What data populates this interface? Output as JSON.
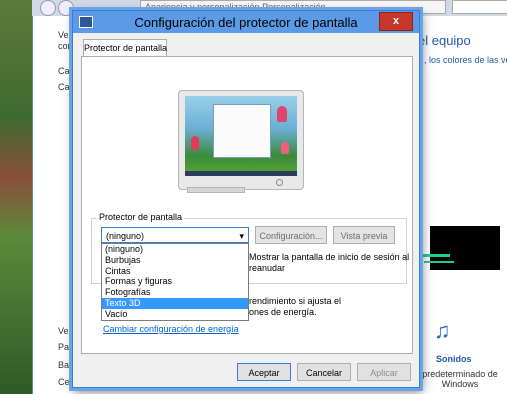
{
  "background": {
    "address_text": "Apariencia y personalización  Personalización",
    "left_texts": [
      "Ven",
      "con",
      "Car",
      "Car",
      "Ver",
      "Par",
      "Bar",
      "Cer"
    ],
    "right_title": "el equipo",
    "right_subtitle": ", los colores de las ven",
    "sounds_label": "Sonidos",
    "default_label": "predeterminado de Windows"
  },
  "dialog": {
    "title": "Configuración del protector de pantalla",
    "close_label": "x",
    "tab_label": "Protector de pantalla",
    "group_label": "Protector de pantalla",
    "selected_value": "(ninguno)",
    "settings_button": "Configuración...",
    "preview_button": "Vista previa",
    "resume_text_line1": "Mostrar la pantalla de inicio de sesión al",
    "resume_text_line2": "reanudar",
    "power_text_line1": "rendimiento si ajusta el",
    "power_text_line2": "ones de energía.",
    "power_link": "Cambiar configuración de energía",
    "dropdown_options": [
      "(ninguno)",
      "Burbujas",
      "Cintas",
      "Formas y figuras",
      "Fotografías",
      "Texto 3D",
      "Vacío"
    ],
    "highlighted_option": "Texto 3D",
    "ok_button": "Aceptar",
    "cancel_button": "Cancelar",
    "apply_button": "Aplicar"
  },
  "colors": {
    "titlebar": "#5a9ae6",
    "close": "#c7372a",
    "highlight": "#3399ff",
    "link": "#0066cc"
  }
}
